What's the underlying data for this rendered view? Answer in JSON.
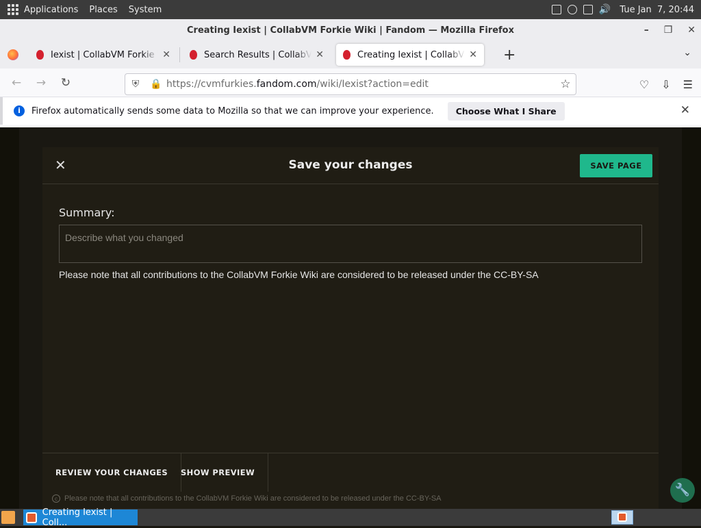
{
  "panel": {
    "applications": "Applications",
    "places": "Places",
    "system": "System",
    "clock": "Tue Jan  7, 20:44"
  },
  "window": {
    "title": "Creating Iexist | CollabVM Forkie Wiki | Fandom — Mozilla Firefox"
  },
  "tabs": [
    {
      "label": "Iexist | CollabVM Forkie Wiki"
    },
    {
      "label": "Search Results | CollabVM F"
    },
    {
      "label": "Creating Iexist | CollabVM F"
    }
  ],
  "navbar": {
    "url_prefix": "https://cvmfurkies.",
    "url_domain": "fandom.com",
    "url_suffix": "/wiki/Iexist?action=edit"
  },
  "infobar": {
    "message": "Firefox automatically sends some data to Mozilla so that we can improve your experience.",
    "button": "Choose What I Share"
  },
  "modal": {
    "title": "Save your changes",
    "save_button": "SAVE PAGE",
    "summary_label": "Summary:",
    "summary_placeholder": "Describe what you changed",
    "note": "Please note that all contributions to the CollabVM Forkie Wiki are considered to be released under the CC-BY-SA",
    "review_button": "REVIEW YOUR CHANGES",
    "preview_button": "SHOW PREVIEW",
    "footer_note": "Please note that all contributions to the CollabVM Forkie Wiki are considered to be released under the CC-BY-SA"
  },
  "taskbar": {
    "task_label": "Creating Iexist | Coll..."
  },
  "colors": {
    "save_button": "#1fb88c",
    "modal_bg": "#201d14",
    "taskbar_task": "#1d87d6"
  }
}
